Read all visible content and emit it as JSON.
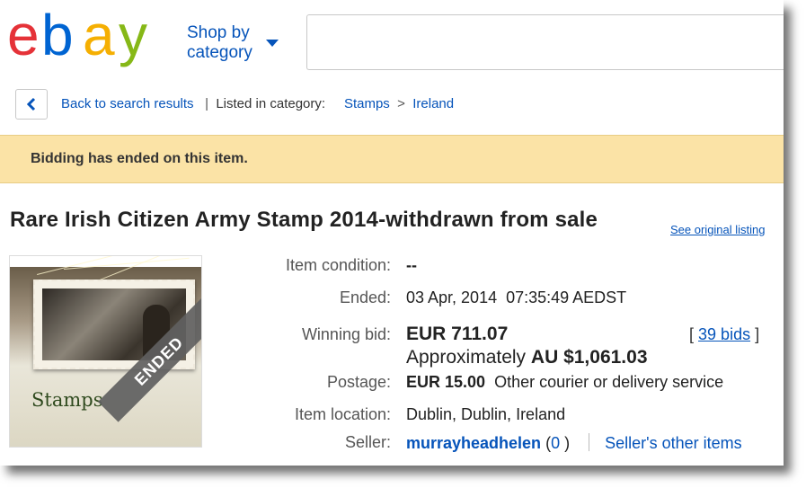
{
  "header": {
    "logo_letters": [
      "e",
      "b",
      "a",
      "y"
    ],
    "logo_colors": [
      "#e53238",
      "#0064d2",
      "#f5af02",
      "#86b817"
    ],
    "shop_by_line1": "Shop by",
    "shop_by_line2": "category",
    "search_placeholder": ""
  },
  "breadcrumb": {
    "back_label": "Back to search results",
    "separator": "|",
    "listed_label": "Listed in category:",
    "category": "Stamps",
    "arrow": ">",
    "subcategory": "Ireland"
  },
  "banner": {
    "text": "Bidding has ended on this item."
  },
  "listing": {
    "title": "Rare Irish Citizen Army Stamp 2014-withdrawn from sale",
    "see_original": "See original listing",
    "image": {
      "caption": "Stamps",
      "overlay": "ENDED"
    },
    "details": {
      "condition_label": "Item condition:",
      "condition_value": "--",
      "ended_label": "Ended:",
      "ended_value": "03 Apr, 2014  07:35:49 AEDST",
      "winning_label": "Winning bid:",
      "winning_value": "EUR 711.07",
      "bids_open": "[",
      "bids_link": "39 bids",
      "bids_close": "]",
      "approx_prefix": "Approximately",
      "approx_value": "AU $1,061.03",
      "postage_label": "Postage:",
      "postage_value": "EUR 15.00",
      "postage_service": "Other courier or delivery service",
      "location_label": "Item location:",
      "location_value": "Dublin, Dublin, Ireland",
      "seller_label": "Seller:",
      "seller_name": "murrayheadhelen",
      "seller_feedback_open": "(",
      "seller_feedback": "0",
      "seller_feedback_close": ")",
      "seller_other": "Seller's other items"
    }
  },
  "colors": {
    "link": "#0654ba",
    "banner_bg": "#fbe3a6"
  }
}
